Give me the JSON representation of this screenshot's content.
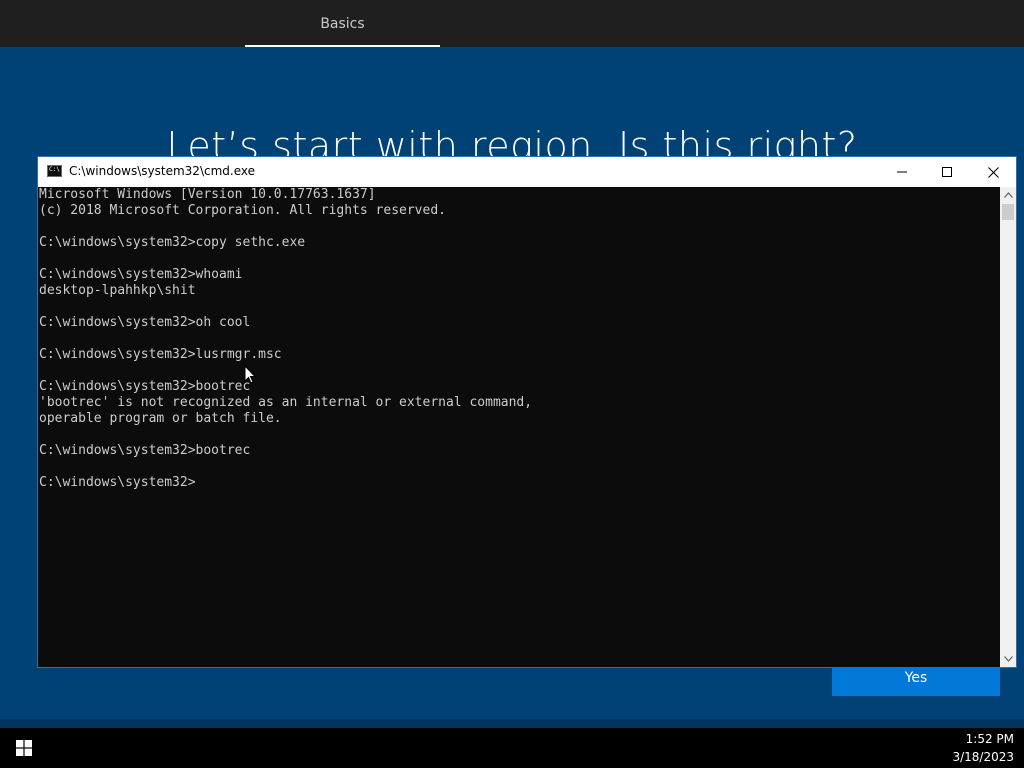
{
  "oobe": {
    "tab_label": "Basics",
    "heading": "Let’s start with region. Is this right?",
    "yes_label": "Yes"
  },
  "cmd": {
    "title": "C:\\windows\\system32\\cmd.exe",
    "lines": [
      "Microsoft Windows [Version 10.0.17763.1637]",
      "(c) 2018 Microsoft Corporation. All rights reserved.",
      "",
      "C:\\windows\\system32>copy sethc.exe",
      "",
      "C:\\windows\\system32>whoami",
      "desktop-lpahhkp\\shit",
      "",
      "C:\\windows\\system32>oh cool",
      "",
      "C:\\windows\\system32>lusrmgr.msc",
      "",
      "C:\\windows\\system32>bootrec",
      "'bootrec' is not recognized as an internal or external command,",
      "operable program or batch file.",
      "",
      "C:\\windows\\system32>bootrec",
      "",
      "C:\\windows\\system32>"
    ]
  },
  "taskbar": {
    "time": "1:52 PM",
    "date": "3/18/2023"
  },
  "icons": {
    "cmd_app": "cmd-app-icon",
    "minimize": "minimize-icon",
    "maximize": "maximize-icon",
    "close": "close-icon",
    "start": "windows-logo-icon",
    "cursor": "mouse-pointer-icon"
  },
  "colors": {
    "oobe_background": "#004275",
    "accent": "#0078d7",
    "console_background": "#0c0c0c",
    "console_text": "#cccccc"
  }
}
